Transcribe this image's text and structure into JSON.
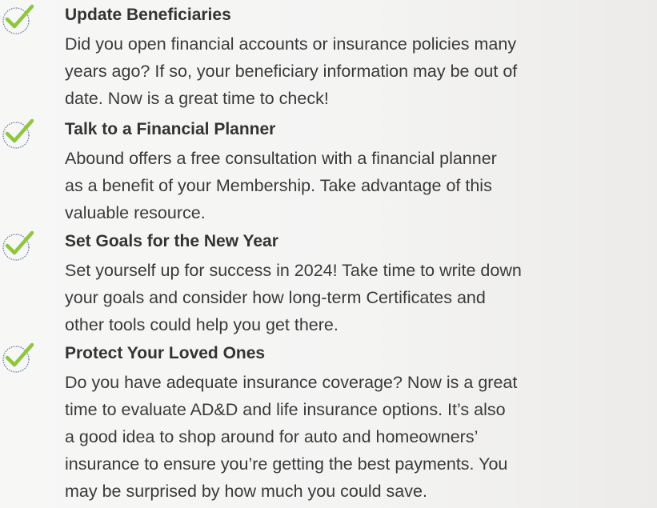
{
  "colors": {
    "check_accent": "#8dc63f",
    "check_ring": "#6a7fa8",
    "text": "#333333"
  },
  "items": [
    {
      "icon": "check-circle-icon",
      "title": "Update Beneficiaries",
      "lines": [
        "Did you open financial accounts or insurance policies many",
        "years ago? If so, your beneficiary information may be out of",
        "date. Now is a great time to check!"
      ]
    },
    {
      "icon": "check-circle-icon",
      "title": "Talk to a Financial Planner",
      "lines": [
        "Abound offers a free consultation with a financial planner",
        "as a benefit of your Membership. Take advantage of this",
        "valuable resource."
      ]
    },
    {
      "icon": "check-circle-icon",
      "title": "Set Goals for the New Year",
      "lines": [
        "Set yourself up for success in 2024! Take time to write down",
        "your goals and consider how long-term Certificates and",
        "other tools could help you get there."
      ]
    },
    {
      "icon": "check-circle-icon",
      "title": "Protect Your Loved Ones",
      "lines": [
        "Do you have adequate insurance coverage? Now is a great",
        "time to evaluate AD&D and life insurance options. It’s also",
        "a good idea to shop around for auto and homeowners’",
        "insurance to ensure you’re getting the best payments. You",
        "may be surprised by how much you could save."
      ]
    }
  ]
}
